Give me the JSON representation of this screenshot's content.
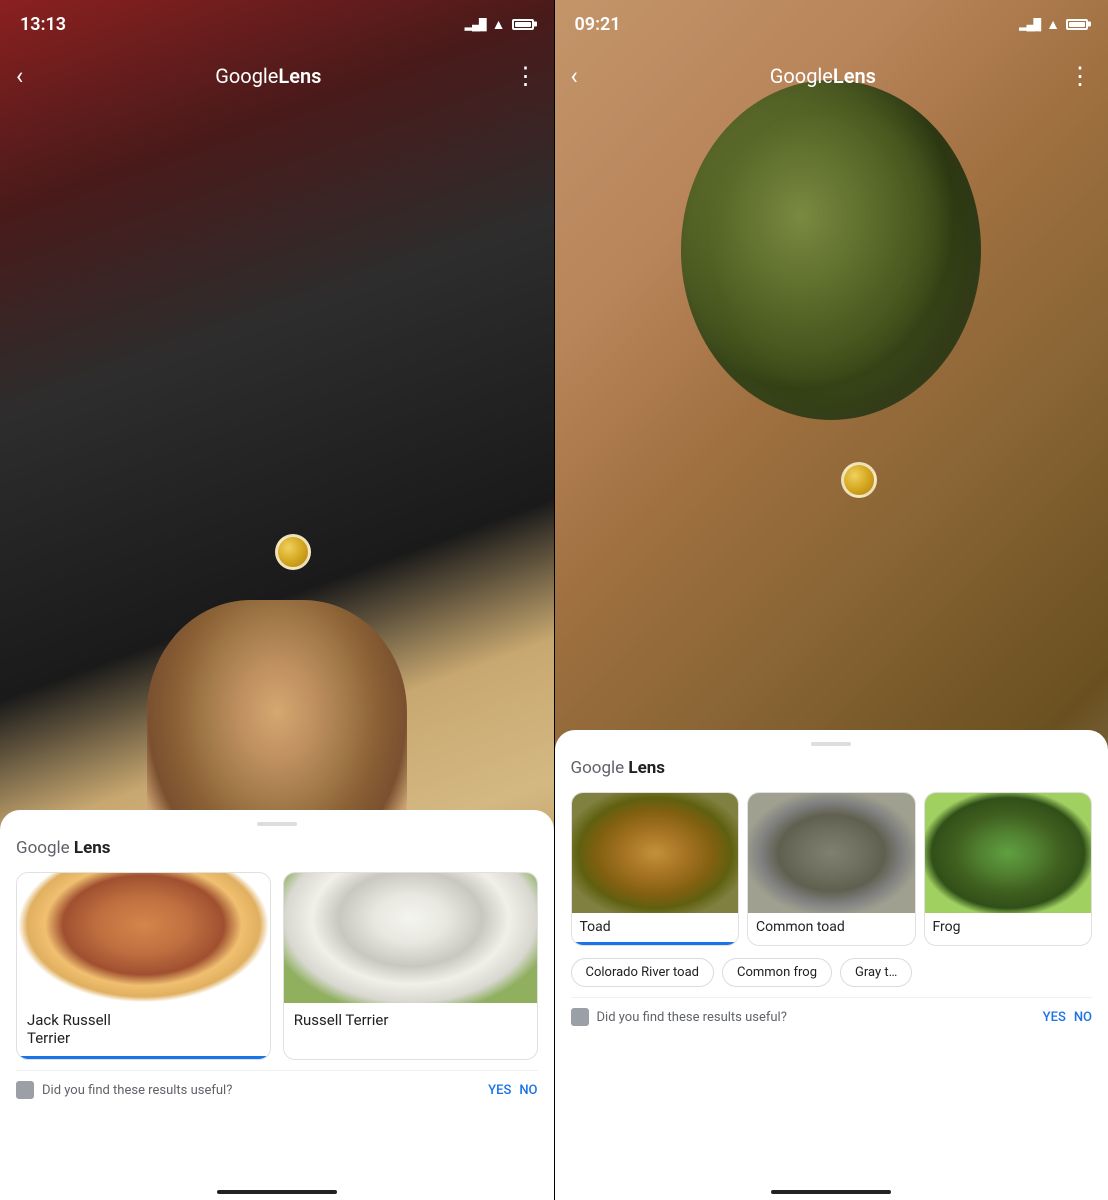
{
  "left_phone": {
    "status": {
      "time": "13:13",
      "signal": "▂▄▆",
      "wifi": "WiFi",
      "battery": "100"
    },
    "header": {
      "back": "<",
      "title_google": "Google",
      "title_lens": " Lens",
      "more": "⋮"
    },
    "sheet": {
      "title_google": "Google",
      "title_lens": " Lens",
      "cards": [
        {
          "label": "Jack Russell\nTerrier",
          "selected": true
        },
        {
          "label": "Russell Terrier",
          "selected": false
        }
      ],
      "feedback_text": "Did you find these results useful?",
      "yes_label": "YES",
      "no_label": "NO"
    }
  },
  "right_phone": {
    "status": {
      "time": "09:21",
      "signal": "▂▄▆",
      "wifi": "WiFi",
      "battery": "100"
    },
    "header": {
      "back": "<",
      "title_google": "Google",
      "title_lens": " Lens",
      "more": "⋮"
    },
    "sheet": {
      "title_google": "Google",
      "title_lens": " Lens",
      "toad_cards": [
        {
          "label": "Toad",
          "selected": true
        },
        {
          "label": "Common toad",
          "selected": false
        },
        {
          "label": "Frog",
          "selected": false
        }
      ],
      "chips": [
        "Colorado River toad",
        "Common frog",
        "Gray t…"
      ],
      "feedback_text": "Did you find these results useful?",
      "yes_label": "YES",
      "no_label": "NO"
    }
  }
}
